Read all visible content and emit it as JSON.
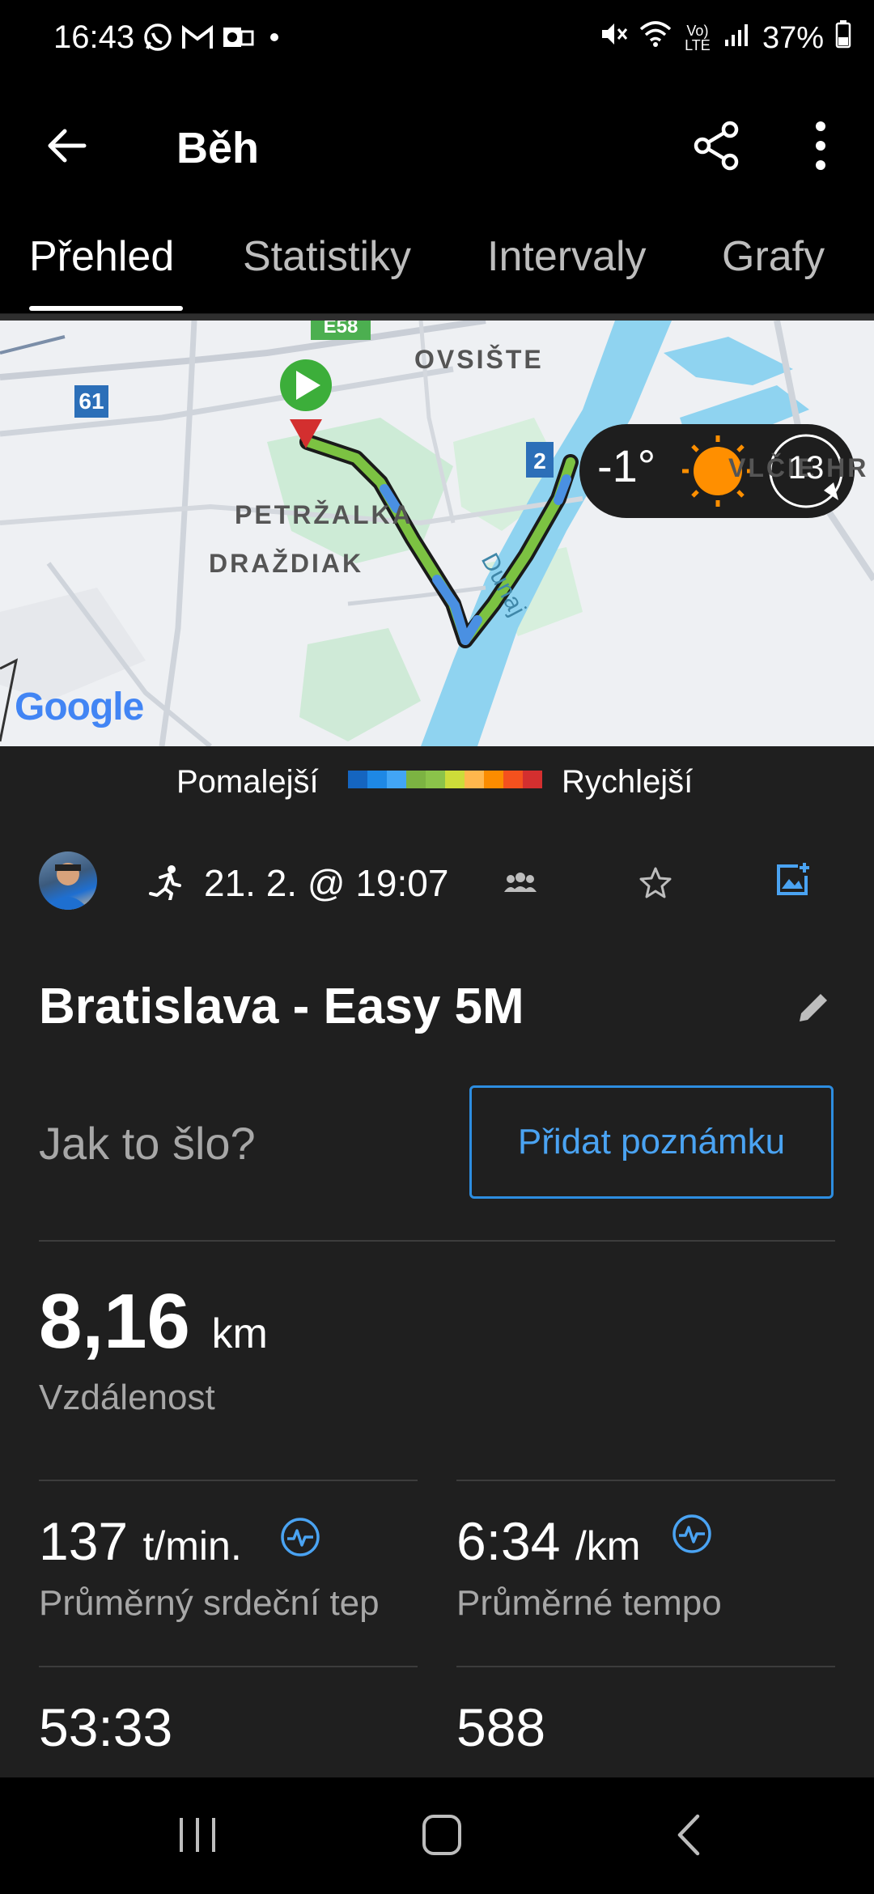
{
  "status_bar": {
    "time": "16:43",
    "battery": "37%",
    "network_label": "Vo) LTE"
  },
  "app_bar": {
    "title": "Běh"
  },
  "tabs": [
    {
      "label": "Přehled",
      "active": true
    },
    {
      "label": "Statistiky",
      "active": false
    },
    {
      "label": "Intervaly",
      "active": false
    },
    {
      "label": "Grafy",
      "active": false
    }
  ],
  "map": {
    "labels": {
      "ovsiste": "OVSIŠTE",
      "petrzalka": "PETRŽALKA",
      "drazdiak": "DRAŽDIAK",
      "vlcie": "VLČIE HR",
      "dunaj": "Dunaj",
      "road_61": "61",
      "road_2": "2",
      "road_e58": "E58",
      "google": "Google"
    },
    "weather": {
      "temperature": "-1°",
      "wind": "13"
    }
  },
  "legend": {
    "slow_label": "Pomalejší",
    "fast_label": "Rychlejší",
    "colors": [
      "#1565c0",
      "#1e88e5",
      "#42a5f5",
      "#7cb342",
      "#8bc34a",
      "#cddc39",
      "#ffb74d",
      "#fb8c00",
      "#f4511e",
      "#d32f2f"
    ]
  },
  "activity": {
    "datetime": "21. 2. @ 19:07",
    "title": "Bratislava - Easy 5M",
    "how_prompt": "Jak to šlo?",
    "add_note_label": "Přidat poznámku"
  },
  "stats": {
    "distance": {
      "value": "8,16",
      "unit": "km",
      "label": "Vzdálenost"
    },
    "avg_hr": {
      "value": "137",
      "unit": "t/min.",
      "label": "Průměrný srdeční tep"
    },
    "avg_pace": {
      "value": "6:34",
      "unit": "/km",
      "label": "Průměrné tempo"
    },
    "time": {
      "value": "53:33"
    },
    "calories": {
      "value": "588"
    }
  },
  "colors": {
    "accent": "#2d8de0",
    "background": "#1f1f1f"
  }
}
